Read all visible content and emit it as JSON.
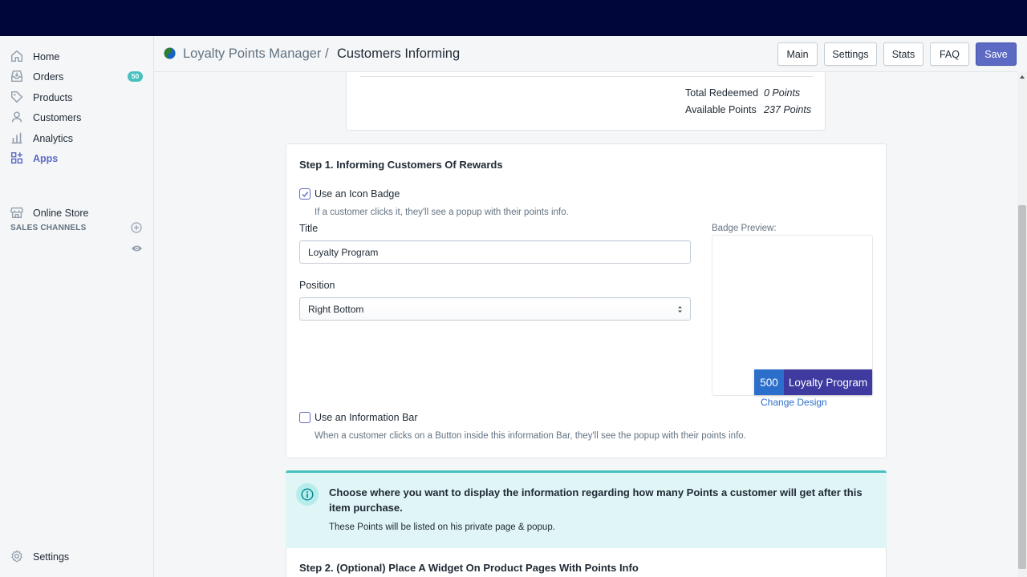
{
  "sidebar": {
    "items": [
      {
        "label": "Home",
        "icon": "home-icon"
      },
      {
        "label": "Orders",
        "icon": "orders-icon",
        "badge": "50"
      },
      {
        "label": "Products",
        "icon": "tag-icon"
      },
      {
        "label": "Customers",
        "icon": "person-icon"
      },
      {
        "label": "Analytics",
        "icon": "bar-chart-icon"
      },
      {
        "label": "Apps",
        "icon": "apps-icon",
        "active": true
      }
    ],
    "sales_channels_heading": "SALES CHANNELS",
    "online_store": "Online Store",
    "settings": "Settings"
  },
  "header": {
    "app_name": "Loyalty Points Manager",
    "separator": "/",
    "page_title": "Customers Informing",
    "buttons": {
      "main": "Main",
      "settings": "Settings",
      "stats": "Stats",
      "faq": "FAQ",
      "save": "Save"
    }
  },
  "summary": {
    "total_redeemed_label": "Total Redeemed",
    "total_redeemed_value": "0 Points",
    "available_label": "Available Points",
    "available_value": "237 Points"
  },
  "step1": {
    "heading": "Step 1. Informing Customers Of Rewards",
    "icon_badge_label": "Use an Icon Badge",
    "icon_badge_checked": true,
    "icon_badge_help": "If a customer clicks it, they'll see a popup with their points info.",
    "title_label": "Title",
    "title_value": "Loyalty Program",
    "position_label": "Position",
    "position_value": "Right Bottom",
    "preview_label": "Badge Preview:",
    "badge_number": "500",
    "badge_text": "Loyalty Program",
    "change_design": "Change Design",
    "info_bar_label": "Use an Information Bar",
    "info_bar_checked": false,
    "info_bar_help": "When a customer clicks on a Button inside this information Bar, they'll see the popup with their points info."
  },
  "banner": {
    "title": "Choose where you want to display the information regarding how many Points a customer will get after this item purchase.",
    "body": "These Points will be listed on his private page & popup."
  },
  "step2": {
    "heading": "Step 2. (Optional) Place A Widget On Product Pages With Points Info"
  },
  "colors": {
    "topbar": "#000639",
    "accent": "#5c6ac4",
    "teal": "#47c1bf",
    "badge_number_bg": "#2c6ecb",
    "badge_text_bg": "#3e3a9f"
  }
}
